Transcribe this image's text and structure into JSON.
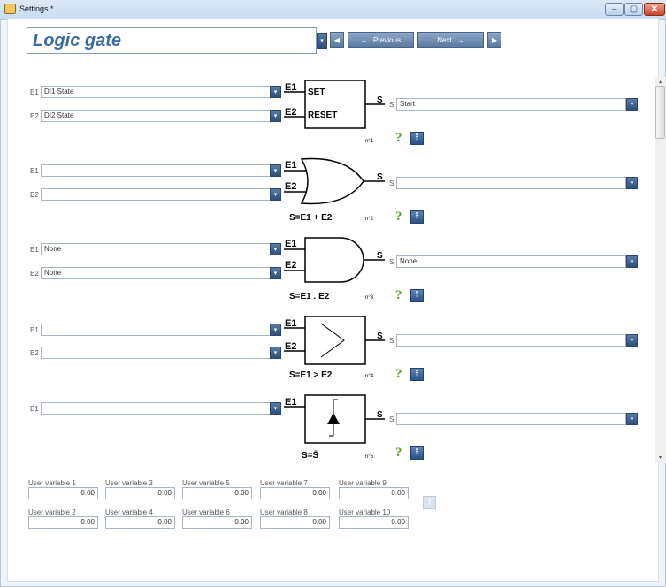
{
  "window": {
    "title": "Settings *",
    "minimize": "–",
    "maximize": "▢",
    "close": "✕"
  },
  "header": {
    "page_title": "Logic gate",
    "prev_label": "Previous",
    "next_label": "Next",
    "first_icon": "◀",
    "last_icon": "▶",
    "prev_arrow": "←",
    "next_arrow": "→"
  },
  "gates": [
    {
      "number": "n°1",
      "type": "set-reset",
      "formula": "",
      "inputs": [
        {
          "label": "E1",
          "value": "DI1 State"
        },
        {
          "label": "E2",
          "value": "DI2 State"
        }
      ],
      "output_label": "S",
      "output_value": "Start",
      "pin_e1": "E1",
      "pin_e2": "E2",
      "pin_s": "S",
      "set_text": "SET",
      "reset_text": "RESET"
    },
    {
      "number": "n°2",
      "type": "or",
      "formula": "S=E1 + E2",
      "inputs": [
        {
          "label": "E1",
          "value": ""
        },
        {
          "label": "E2",
          "value": ""
        }
      ],
      "output_label": "S",
      "output_value": "",
      "pin_e1": "E1",
      "pin_e2": "E2",
      "pin_s": "S"
    },
    {
      "number": "n°3",
      "type": "and",
      "formula": "S=E1 . E2",
      "inputs": [
        {
          "label": "E1",
          "value": "None"
        },
        {
          "label": "E2",
          "value": "None"
        }
      ],
      "output_label": "S",
      "output_value": "None",
      "pin_e1": "E1",
      "pin_e2": "E2",
      "pin_s": "S"
    },
    {
      "number": "n°4",
      "type": "greater-than",
      "formula": "S=E1 > E2",
      "inputs": [
        {
          "label": "E1",
          "value": ""
        },
        {
          "label": "E2",
          "value": ""
        }
      ],
      "output_label": "S",
      "output_value": "",
      "pin_e1": "E1",
      "pin_e2": "E2",
      "pin_s": "S"
    },
    {
      "number": "n°5",
      "type": "edge-invert",
      "formula": "S=S̄",
      "inputs": [
        {
          "label": "E1",
          "value": ""
        }
      ],
      "output_label": "S",
      "output_value": "",
      "pin_e1": "E1",
      "pin_s": "S"
    }
  ],
  "icons": {
    "help": "?",
    "upload": "⭱",
    "dropdown": "▾",
    "scroll_up": "▴",
    "scroll_down": "▾"
  },
  "user_variables": [
    {
      "label": "User variable 1",
      "value": "0.00"
    },
    {
      "label": "User variable 2",
      "value": "0.00"
    },
    {
      "label": "User variable 3",
      "value": "0.00"
    },
    {
      "label": "User variable 4",
      "value": "0.00"
    },
    {
      "label": "User variable 5",
      "value": "0.00"
    },
    {
      "label": "User variable 6",
      "value": "0.00"
    },
    {
      "label": "User variable 7",
      "value": "0.00"
    },
    {
      "label": "User variable 8",
      "value": "0.00"
    },
    {
      "label": "User variable 9",
      "value": "0.00"
    },
    {
      "label": "User variable 10",
      "value": "0.00"
    }
  ]
}
